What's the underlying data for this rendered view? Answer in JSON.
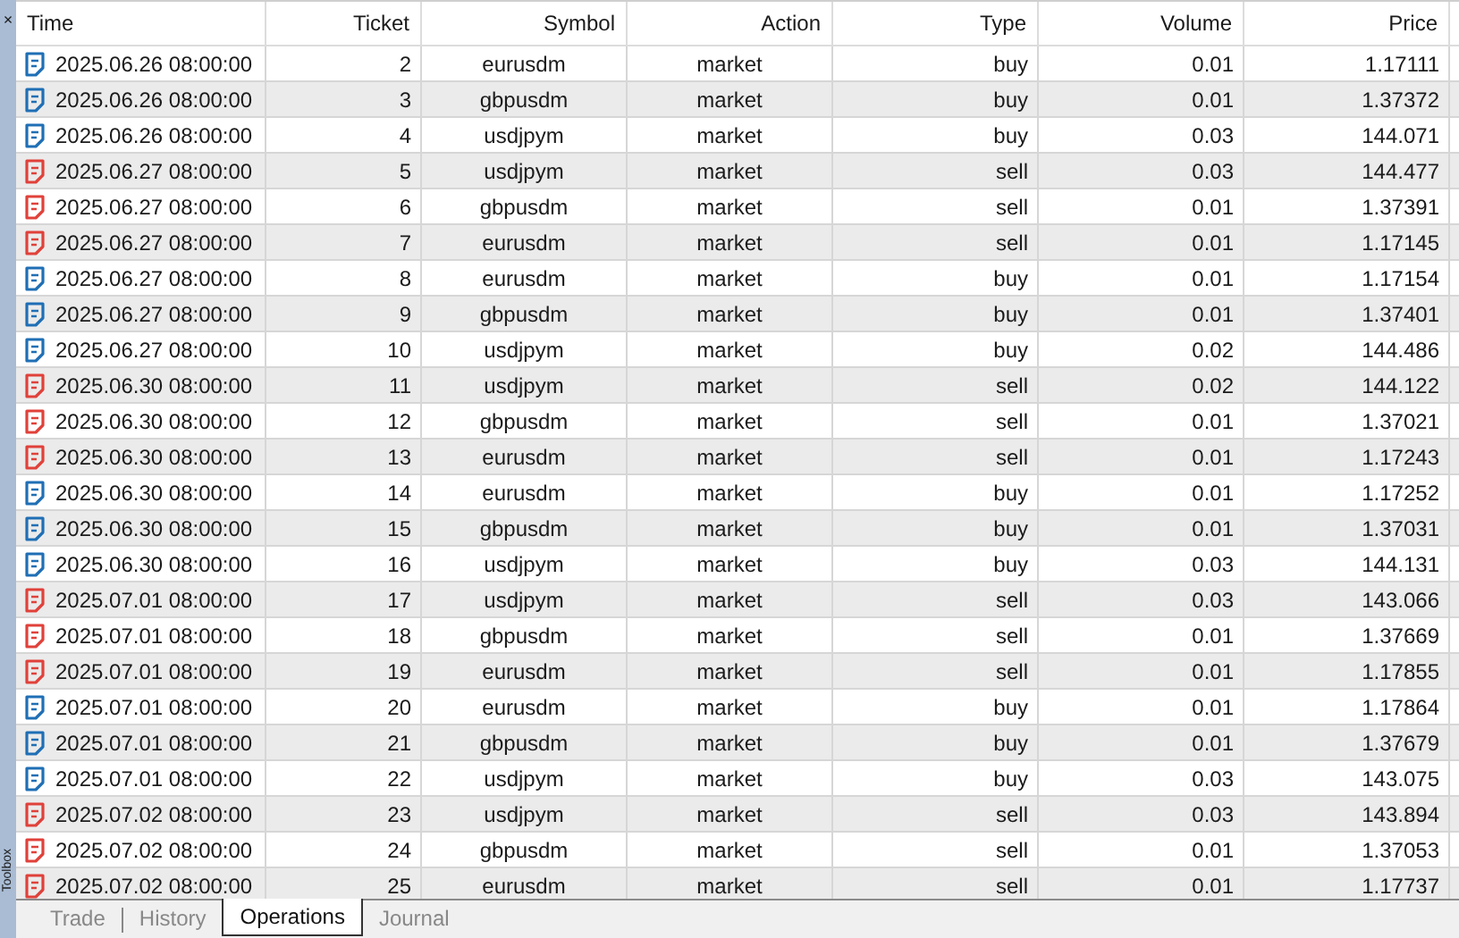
{
  "sidebar": {
    "close": "×",
    "title": "Toolbox"
  },
  "table": {
    "columns": [
      "Time",
      "Ticket",
      "Symbol",
      "Action",
      "Type",
      "Volume",
      "Price"
    ],
    "rows": [
      {
        "time": "2025.06.26 08:00:00",
        "ticket": "2",
        "symbol": "eurusdm",
        "action": "market",
        "type": "buy",
        "volume": "0.01",
        "price": "1.17111",
        "color": "#1f6fb5"
      },
      {
        "time": "2025.06.26 08:00:00",
        "ticket": "3",
        "symbol": "gbpusdm",
        "action": "market",
        "type": "buy",
        "volume": "0.01",
        "price": "1.37372",
        "color": "#1f6fb5"
      },
      {
        "time": "2025.06.26 08:00:00",
        "ticket": "4",
        "symbol": "usdjpym",
        "action": "market",
        "type": "buy",
        "volume": "0.03",
        "price": "144.071",
        "color": "#1f6fb5"
      },
      {
        "time": "2025.06.27 08:00:00",
        "ticket": "5",
        "symbol": "usdjpym",
        "action": "market",
        "type": "sell",
        "volume": "0.03",
        "price": "144.477",
        "color": "#e0413a"
      },
      {
        "time": "2025.06.27 08:00:00",
        "ticket": "6",
        "symbol": "gbpusdm",
        "action": "market",
        "type": "sell",
        "volume": "0.01",
        "price": "1.37391",
        "color": "#e0413a"
      },
      {
        "time": "2025.06.27 08:00:00",
        "ticket": "7",
        "symbol": "eurusdm",
        "action": "market",
        "type": "sell",
        "volume": "0.01",
        "price": "1.17145",
        "color": "#e0413a"
      },
      {
        "time": "2025.06.27 08:00:00",
        "ticket": "8",
        "symbol": "eurusdm",
        "action": "market",
        "type": "buy",
        "volume": "0.01",
        "price": "1.17154",
        "color": "#1f6fb5"
      },
      {
        "time": "2025.06.27 08:00:00",
        "ticket": "9",
        "symbol": "gbpusdm",
        "action": "market",
        "type": "buy",
        "volume": "0.01",
        "price": "1.37401",
        "color": "#1f6fb5"
      },
      {
        "time": "2025.06.27 08:00:00",
        "ticket": "10",
        "symbol": "usdjpym",
        "action": "market",
        "type": "buy",
        "volume": "0.02",
        "price": "144.486",
        "color": "#1f6fb5"
      },
      {
        "time": "2025.06.30 08:00:00",
        "ticket": "11",
        "symbol": "usdjpym",
        "action": "market",
        "type": "sell",
        "volume": "0.02",
        "price": "144.122",
        "color": "#e0413a"
      },
      {
        "time": "2025.06.30 08:00:00",
        "ticket": "12",
        "symbol": "gbpusdm",
        "action": "market",
        "type": "sell",
        "volume": "0.01",
        "price": "1.37021",
        "color": "#e0413a"
      },
      {
        "time": "2025.06.30 08:00:00",
        "ticket": "13",
        "symbol": "eurusdm",
        "action": "market",
        "type": "sell",
        "volume": "0.01",
        "price": "1.17243",
        "color": "#e0413a"
      },
      {
        "time": "2025.06.30 08:00:00",
        "ticket": "14",
        "symbol": "eurusdm",
        "action": "market",
        "type": "buy",
        "volume": "0.01",
        "price": "1.17252",
        "color": "#1f6fb5"
      },
      {
        "time": "2025.06.30 08:00:00",
        "ticket": "15",
        "symbol": "gbpusdm",
        "action": "market",
        "type": "buy",
        "volume": "0.01",
        "price": "1.37031",
        "color": "#1f6fb5"
      },
      {
        "time": "2025.06.30 08:00:00",
        "ticket": "16",
        "symbol": "usdjpym",
        "action": "market",
        "type": "buy",
        "volume": "0.03",
        "price": "144.131",
        "color": "#1f6fb5"
      },
      {
        "time": "2025.07.01 08:00:00",
        "ticket": "17",
        "symbol": "usdjpym",
        "action": "market",
        "type": "sell",
        "volume": "0.03",
        "price": "143.066",
        "color": "#e0413a"
      },
      {
        "time": "2025.07.01 08:00:00",
        "ticket": "18",
        "symbol": "gbpusdm",
        "action": "market",
        "type": "sell",
        "volume": "0.01",
        "price": "1.37669",
        "color": "#e0413a"
      },
      {
        "time": "2025.07.01 08:00:00",
        "ticket": "19",
        "symbol": "eurusdm",
        "action": "market",
        "type": "sell",
        "volume": "0.01",
        "price": "1.17855",
        "color": "#e0413a"
      },
      {
        "time": "2025.07.01 08:00:00",
        "ticket": "20",
        "symbol": "eurusdm",
        "action": "market",
        "type": "buy",
        "volume": "0.01",
        "price": "1.17864",
        "color": "#1f6fb5"
      },
      {
        "time": "2025.07.01 08:00:00",
        "ticket": "21",
        "symbol": "gbpusdm",
        "action": "market",
        "type": "buy",
        "volume": "0.01",
        "price": "1.37679",
        "color": "#1f6fb5"
      },
      {
        "time": "2025.07.01 08:00:00",
        "ticket": "22",
        "symbol": "usdjpym",
        "action": "market",
        "type": "buy",
        "volume": "0.03",
        "price": "143.075",
        "color": "#1f6fb5"
      },
      {
        "time": "2025.07.02 08:00:00",
        "ticket": "23",
        "symbol": "usdjpym",
        "action": "market",
        "type": "sell",
        "volume": "0.03",
        "price": "143.894",
        "color": "#e0413a"
      },
      {
        "time": "2025.07.02 08:00:00",
        "ticket": "24",
        "symbol": "gbpusdm",
        "action": "market",
        "type": "sell",
        "volume": "0.01",
        "price": "1.37053",
        "color": "#e0413a"
      },
      {
        "time": "2025.07.02 08:00:00",
        "ticket": "25",
        "symbol": "eurusdm",
        "action": "market",
        "type": "sell",
        "volume": "0.01",
        "price": "1.17737",
        "color": "#e0413a"
      }
    ]
  },
  "tabs": [
    {
      "label": "Trade",
      "selected": false
    },
    {
      "label": "History",
      "selected": false
    },
    {
      "label": "Operations",
      "selected": true
    },
    {
      "label": "Journal",
      "selected": false
    }
  ]
}
